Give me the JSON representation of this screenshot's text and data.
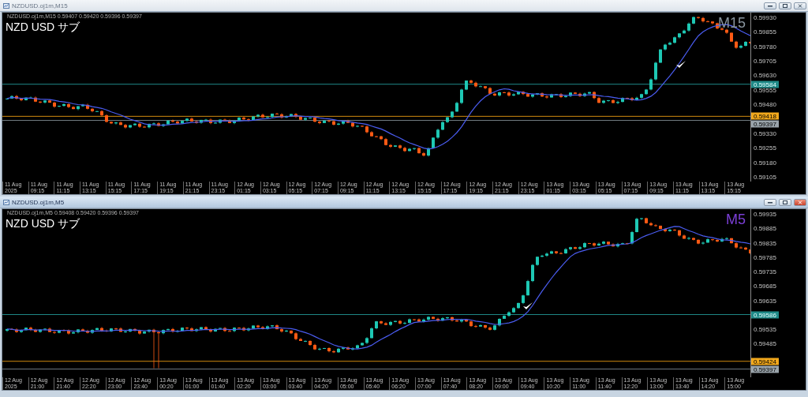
{
  "panels": [
    {
      "window_title": "NZDUSD.oj1m,M15",
      "active": false,
      "symbol_info": "NZDUSD.oj1m,M15  0.59407 0.59420 0.59396 0.59397",
      "overlay_label": "NZD USD サブ",
      "timeframe": {
        "label": "M15",
        "color": "#8a96a0"
      },
      "price_ticks": [
        "0.59930",
        "0.59855",
        "0.59780",
        "0.59705",
        "0.59630",
        "0.59555",
        "0.59480",
        "0.59330",
        "0.59255",
        "0.59180",
        "0.59105"
      ],
      "price_tags": [
        {
          "text": "0.59584",
          "kind": "line"
        },
        {
          "text": "0.59418",
          "kind": "ask"
        },
        {
          "text": "0.59397",
          "kind": "bid"
        }
      ],
      "time_labels": [
        "11 Aug 2025",
        "11 Aug 09:15",
        "11 Aug 11:15",
        "11 Aug 13:15",
        "11 Aug 15:15",
        "11 Aug 17:15",
        "11 Aug 19:15",
        "11 Aug 21:15",
        "11 Aug 23:15",
        "12 Aug 01:15",
        "12 Aug 03:15",
        "12 Aug 05:15",
        "12 Aug 07:15",
        "12 Aug 09:15",
        "12 Aug 11:15",
        "12 Aug 13:15",
        "12 Aug 15:15",
        "12 Aug 17:15",
        "12 Aug 19:15",
        "12 Aug 21:15",
        "12 Aug 23:15",
        "13 Aug 01:15",
        "13 Aug 03:15",
        "13 Aug 05:15",
        "13 Aug 07:15",
        "13 Aug 09:15",
        "13 Aug 11:15",
        "13 Aug 13:15",
        "13 Aug 15:15"
      ]
    },
    {
      "window_title": "NZDUSD.oj1m,M5",
      "active": true,
      "symbol_info": "NZDUSD.oj1m,M5  0.59408 0.59420 0.59396 0.59397",
      "overlay_label": "NZD USD サブ",
      "timeframe": {
        "label": "M5",
        "color": "#7b3fd6"
      },
      "price_ticks": [
        "0.59935",
        "0.59885",
        "0.59835",
        "0.59785",
        "0.59735",
        "0.59685",
        "0.59635",
        "0.59535",
        "0.59485"
      ],
      "price_tags": [
        {
          "text": "0.59586",
          "kind": "line"
        },
        {
          "text": "0.59424",
          "kind": "ask"
        },
        {
          "text": "0.59397",
          "kind": "bid"
        }
      ],
      "time_labels": [
        "12 Aug 2025",
        "12 Aug 21:00",
        "12 Aug 21:40",
        "12 Aug 22:20",
        "12 Aug 23:00",
        "12 Aug 23:40",
        "13 Aug 00:20",
        "13 Aug 01:00",
        "13 Aug 01:40",
        "13 Aug 02:20",
        "13 Aug 03:00",
        "13 Aug 03:40",
        "13 Aug 04:20",
        "13 Aug 05:00",
        "13 Aug 05:40",
        "13 Aug 06:20",
        "13 Aug 07:00",
        "13 Aug 07:40",
        "13 Aug 08:20",
        "13 Aug 09:00",
        "13 Aug 09:40",
        "13 Aug 10:20",
        "13 Aug 11:00",
        "13 Aug 11:40",
        "13 Aug 12:20",
        "13 Aug 13:00",
        "13 Aug 13:40",
        "13 Aug 14:20",
        "13 Aug 15:00"
      ]
    }
  ]
}
